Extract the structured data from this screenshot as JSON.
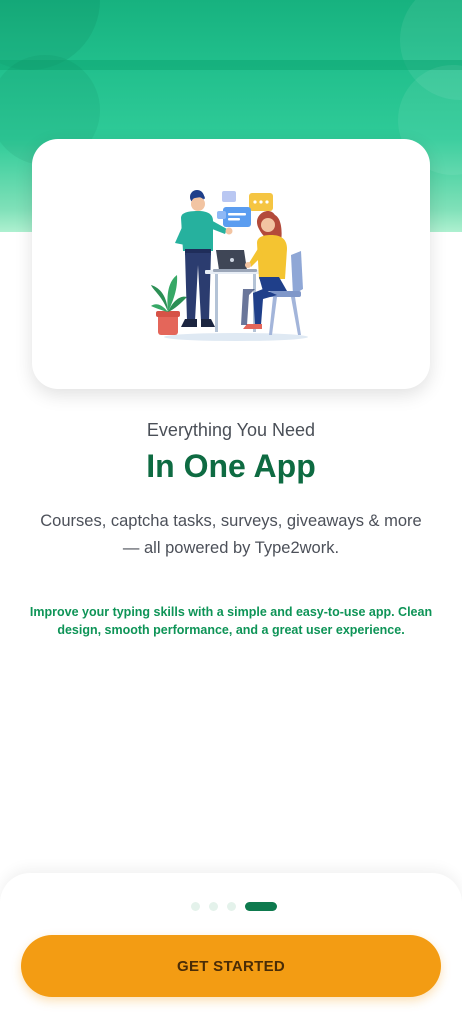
{
  "hero": {
    "illustration": "two people collaborating at a desk with laptop and chat bubbles"
  },
  "onboarding": {
    "kicker": "Everything You Need",
    "title": "In One App",
    "description": "Courses, captcha tasks, surveys, giveaways & more — all powered by Type2work.",
    "note": "Improve your typing skills with a simple and easy-to-use app. Clean design, smooth performance, and a great user experience."
  },
  "pagination": {
    "current_page": 4,
    "total_pages": 4
  },
  "cta": {
    "label": "GET STARTED"
  },
  "colors": {
    "header_green": "#1db882",
    "title_green": "#0e6b42",
    "note_green": "#0e9457",
    "cta_orange": "#f39c13",
    "active_dot": "#0e7a4e"
  }
}
